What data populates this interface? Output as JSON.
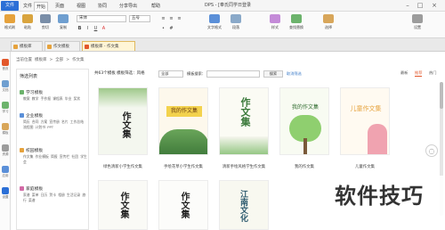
{
  "app": {
    "title": "DPS - [奉氏同学日登录",
    "menu": [
      "文件",
      "开始",
      "页面",
      "视图",
      "协同",
      "分享导出",
      "帮助"
    ],
    "active_menu": "开始",
    "logo": "文件"
  },
  "ribbon": {
    "buttons": [
      "格式刷",
      "粘贴",
      "剪切",
      "复制"
    ],
    "font_name": "宋体",
    "font_size": "五号",
    "right_buttons": [
      "文字格式",
      "段落",
      "样式",
      "查找替换",
      "选择",
      "设置"
    ]
  },
  "tabs": [
    {
      "label": "模板库",
      "close": "×"
    },
    {
      "label": "作文模板",
      "close": "×"
    },
    {
      "label": "模板库 - 作文集",
      "close": "×"
    }
  ],
  "rail": [
    "首页",
    "文档",
    "学习",
    "模板",
    "资源",
    "应用",
    "设置"
  ],
  "breadcrumb": [
    "当前位置",
    "模板库",
    ">",
    "全部",
    ">",
    "作文集"
  ],
  "categories": {
    "title": "筛选列表",
    "groups": [
      {
        "name": "学习模板",
        "items": "教案  教学 手抄报  课程表  毕业 奖状"
      },
      {
        "name": "企业模板",
        "items": "简历  合同  方案  宣传册 名片  工作总结 流程图 计划书  PPT"
      },
      {
        "name": "校园模板",
        "items": "作文集 作业模板 简报 宣传栏 社团 学生会"
      },
      {
        "name": "家庭模板",
        "items": "家谱 菜单 日历  贺卡  相册  生活记录 旅行 菜谱"
      }
    ]
  },
  "filter": {
    "count_text": "共63个模板 模板筛选：风格",
    "style": "全部",
    "type": "模板搜索：",
    "search_placeholder": "",
    "search_btn": "搜索",
    "cancel": "取消筛选"
  },
  "sort": [
    "最新",
    "推荐",
    "热门"
  ],
  "cards": [
    {
      "title": "绿色清新小学生作文集",
      "cover": "作文集"
    },
    {
      "title": "手绘花草小学生作文集",
      "cover": "我的作文集"
    },
    {
      "title": "清新手绘风格学生作文集",
      "cover": "作文集"
    },
    {
      "title": "我的作文集",
      "cover": "我的作文集"
    },
    {
      "title": "儿童作文集",
      "cover": "儿童作文集"
    }
  ],
  "cards_row2": [
    {
      "cover": "作文集"
    },
    {
      "cover": "作文集"
    },
    {
      "cover": "江南文化"
    }
  ],
  "watermark": "软件技巧",
  "colors": {
    "accent": "#2b6fd6",
    "highlight": "#e2572b"
  }
}
